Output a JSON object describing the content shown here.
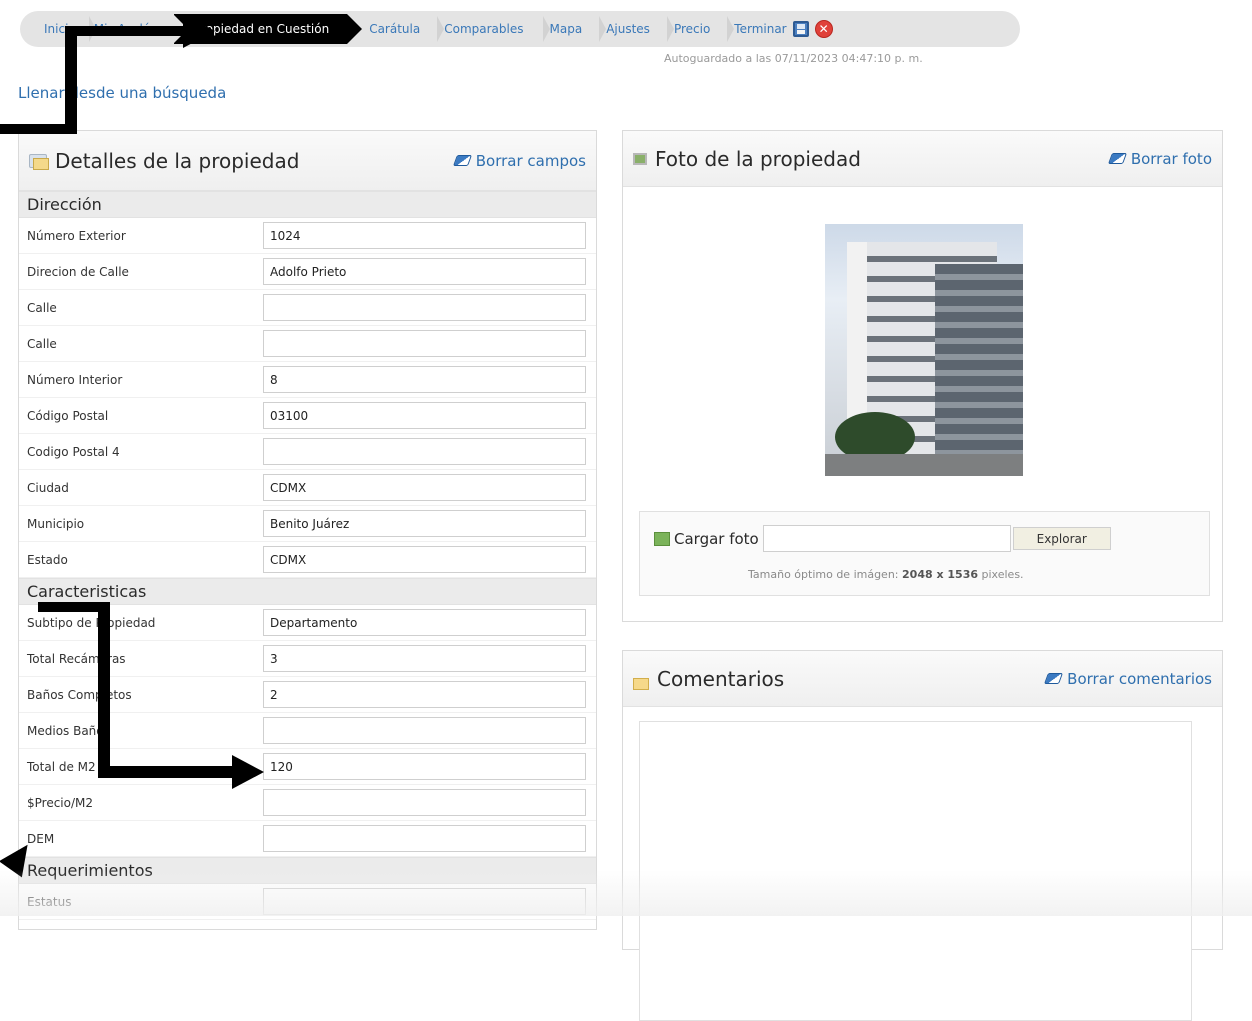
{
  "wizard": {
    "steps": [
      {
        "label": "Inicio",
        "active": false
      },
      {
        "label": "Mis Avalúos",
        "active": false
      },
      {
        "label": "Propiedad en Cuestión",
        "active": true
      },
      {
        "label": "Carátula",
        "active": false
      },
      {
        "label": "Comparables",
        "active": false
      },
      {
        "label": "Mapa",
        "active": false
      },
      {
        "label": "Ajustes",
        "active": false
      },
      {
        "label": "Precio",
        "active": false
      },
      {
        "label": "Terminar",
        "active": false
      }
    ],
    "autosave_text": "Autoguardado a las 07/11/2023 04:47:10 p. m."
  },
  "fill_link": "Llenar desde una búsqueda",
  "details": {
    "title": "Detalles de la propiedad",
    "clear_label": "Borrar campos",
    "sections": [
      {
        "title": "Dirección",
        "fields": [
          {
            "label": "Número Exterior",
            "value": "1024"
          },
          {
            "label": "Direcion de Calle",
            "value": "Adolfo Prieto"
          },
          {
            "label": "Calle",
            "value": ""
          },
          {
            "label": "Calle",
            "value": ""
          },
          {
            "label": "Número Interior",
            "value": "8"
          },
          {
            "label": "Código Postal",
            "value": "03100"
          },
          {
            "label": "Codigo Postal 4",
            "value": ""
          },
          {
            "label": "Ciudad",
            "value": "CDMX"
          },
          {
            "label": "Municipio",
            "value": "Benito Juárez"
          },
          {
            "label": "Estado",
            "value": "CDMX"
          }
        ]
      },
      {
        "title": "Caracteristicas",
        "fields": [
          {
            "label": "Subtipo de Propiedad",
            "value": "Departamento"
          },
          {
            "label": "Total Recámaras",
            "value": "3"
          },
          {
            "label": "Baños Completos",
            "value": "2"
          },
          {
            "label": "Medios Baños",
            "value": ""
          },
          {
            "label": "Total de M2",
            "value": "120"
          },
          {
            "label": "$Precio/M2",
            "value": ""
          },
          {
            "label": "DEM",
            "value": ""
          }
        ]
      },
      {
        "title": "Requerimientos",
        "fields": [
          {
            "label": "Estatus",
            "value": ""
          }
        ]
      }
    ]
  },
  "photo": {
    "title": "Foto de la propiedad",
    "clear_label": "Borrar foto",
    "upload_label": "Cargar foto",
    "browse_label": "Explorar",
    "hint_prefix": "Tamaño óptimo de imágen:",
    "hint_size": "2048 x 1536",
    "hint_suffix": "pixeles."
  },
  "comments": {
    "title": "Comentarios",
    "clear_label": "Borrar comentarios"
  },
  "colors": {
    "link": "#2f6fae",
    "active_step": "#000000",
    "annotation_arrow": "#000000"
  }
}
